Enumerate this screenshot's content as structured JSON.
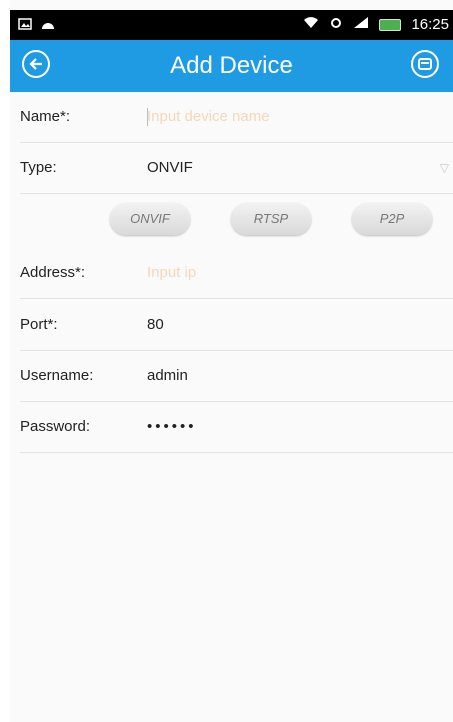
{
  "status_bar": {
    "time": "16:25",
    "icons": [
      "image-icon",
      "android-icon",
      "wifi-icon",
      "sync-icon",
      "signal-icon",
      "battery-icon"
    ]
  },
  "app_bar": {
    "title": "Add Device",
    "back_icon": "back-circle-icon",
    "save_icon": "save-circle-icon"
  },
  "form": {
    "name": {
      "label": "Name*:",
      "placeholder": "Input device name"
    },
    "type": {
      "label": "Type:",
      "value": "ONVIF"
    },
    "address": {
      "label": "Address*:",
      "placeholder": "Input ip"
    },
    "port": {
      "label": "Port*:",
      "value": "80"
    },
    "username": {
      "label": "Username:",
      "value": "admin"
    },
    "password": {
      "label": "Password:",
      "value": "••••••"
    }
  },
  "type_buttons": [
    "ONVIF",
    "RTSP",
    "P2P"
  ],
  "colors": {
    "app_bar": "#1e9be3",
    "placeholder": "#f5d7b8",
    "status_bar": "#000000"
  }
}
